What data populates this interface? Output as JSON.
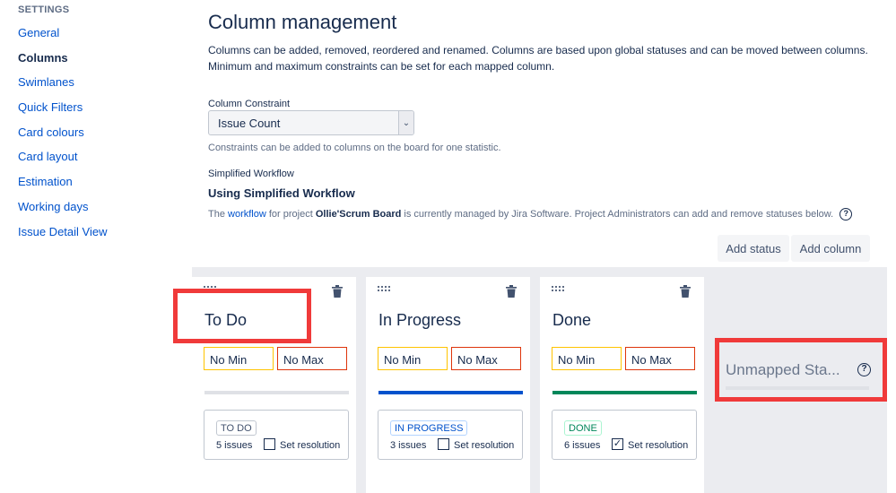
{
  "sidebar": {
    "heading": "SETTINGS",
    "items": [
      {
        "label": "General",
        "active": false
      },
      {
        "label": "Columns",
        "active": true
      },
      {
        "label": "Swimlanes",
        "active": false
      },
      {
        "label": "Quick Filters",
        "active": false
      },
      {
        "label": "Card colours",
        "active": false
      },
      {
        "label": "Card layout",
        "active": false
      },
      {
        "label": "Estimation",
        "active": false
      },
      {
        "label": "Working days",
        "active": false
      },
      {
        "label": "Issue Detail View",
        "active": false
      }
    ]
  },
  "main": {
    "title": "Column management",
    "description": "Columns can be added, removed, reordered and renamed. Columns are based upon global statuses and can be moved between columns. Minimum and maximum constraints can be set for each mapped column.",
    "constraint": {
      "label": "Column Constraint",
      "selected": "Issue Count",
      "help": "Constraints can be added to columns on the board for one statistic."
    },
    "workflow": {
      "label": "Simplified Workflow",
      "heading": "Using Simplified Workflow",
      "text_prefix": "The ",
      "link": "workflow",
      "text_mid": " for project ",
      "project": "Ollie'Scrum Board",
      "text_suffix": " is currently managed by Jira Software. Project Administrators can add and remove statuses below."
    },
    "buttons": {
      "add_status": "Add status",
      "add_column": "Add column"
    }
  },
  "board": {
    "columns": [
      {
        "title": "To Do",
        "min": "No Min",
        "max": "No Max",
        "bar_color": "#dfe1e6",
        "status": "TO DO",
        "status_color": "#42526e",
        "issues": "5 issues",
        "set_resolution": "Set resolution",
        "resolution_checked": false
      },
      {
        "title": "In Progress",
        "min": "No Min",
        "max": "No Max",
        "bar_color": "#0052cc",
        "status": "IN PROGRESS",
        "status_color": "#0052cc",
        "issues": "3 issues",
        "set_resolution": "Set resolution",
        "resolution_checked": false
      },
      {
        "title": "Done",
        "min": "No Min",
        "max": "No Max",
        "bar_color": "#00875a",
        "status": "DONE",
        "status_color": "#00875a",
        "issues": "6 issues",
        "set_resolution": "Set resolution",
        "resolution_checked": true
      }
    ],
    "unmapped": {
      "title": "Unmapped Sta..."
    }
  },
  "colors": {
    "highlight": "#f03a3a",
    "link": "#0052cc"
  }
}
